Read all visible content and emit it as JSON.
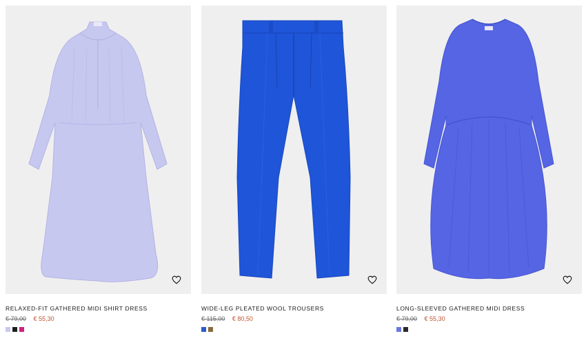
{
  "products": [
    {
      "title": "RELAXED-FIT GATHERED MIDI SHIRT DRESS",
      "old_price": "€ 79,00",
      "new_price": "€ 55,30",
      "garment_color": "#c7c8f0",
      "swatches": [
        "#c9c8ee",
        "#1f1f1f",
        "#d0217a"
      ]
    },
    {
      "title": "WIDE-LEG PLEATED WOOL TROUSERS",
      "old_price": "€ 115,00",
      "new_price": "€ 80,50",
      "garment_color": "#1f55d8",
      "swatches": [
        "#2f5cc9",
        "#8a6a3c"
      ]
    },
    {
      "title": "LONG-SLEEVED GATHERED MIDI DRESS",
      "old_price": "€ 79,00",
      "new_price": "€ 55,30",
      "garment_color": "#5565e3",
      "swatches": [
        "#6a78e0",
        "#2a2a2a"
      ]
    }
  ],
  "icons": {
    "wishlist": "heart-icon"
  }
}
